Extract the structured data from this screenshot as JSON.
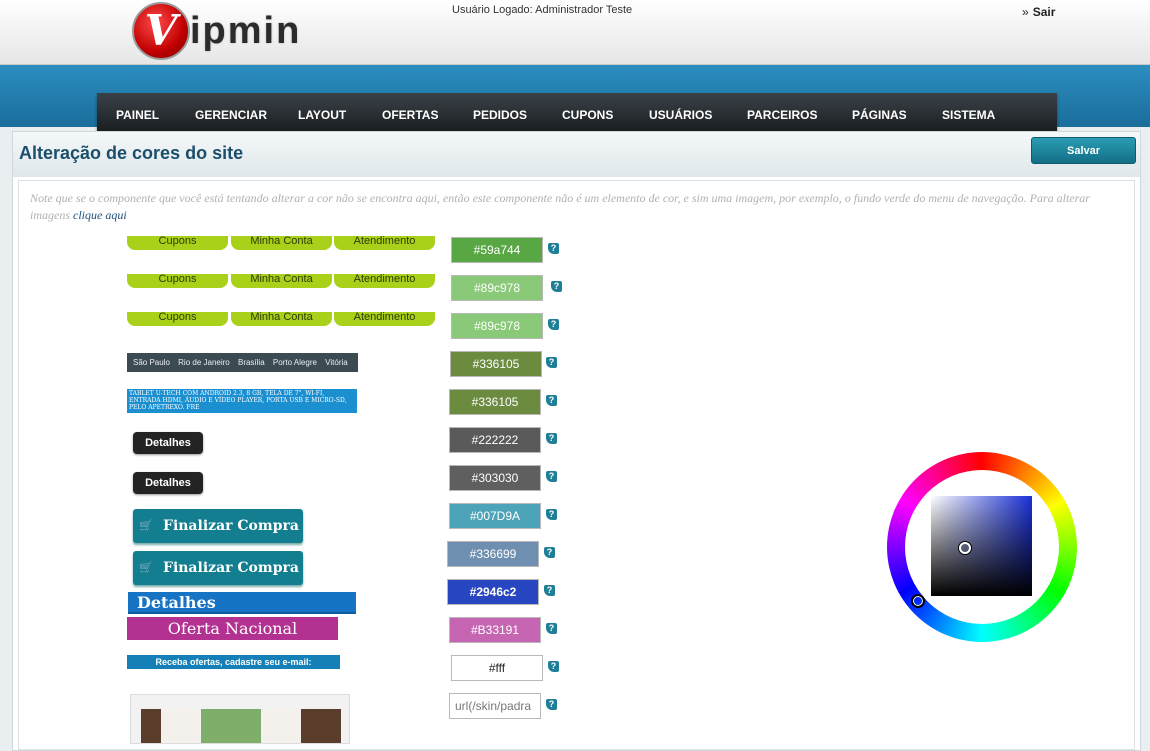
{
  "header": {
    "logo_v": "V",
    "logo_rest": "ipmin",
    "user_info": "Usuário Logado: Administrador Teste",
    "logout_arrow": "»",
    "logout": "Sair"
  },
  "nav": [
    "PAINEL",
    "GERENCIAR",
    "LAYOUT",
    "OFERTAS",
    "PEDIDOS",
    "CUPONS",
    "USUÁRIOS",
    "PARCEIROS",
    "PÁGINAS",
    "SISTEMA"
  ],
  "page": {
    "title": "Alteração de cores do site",
    "save_label": "Salvar",
    "note": "Note que se o componente que você está tentando alterar a cor não se encontra aqui, então este componente não é um elemento de cor, e sim uma imagem, por exemplo, o fundo verde do menu de navegação. Para alterar imagens ",
    "note_link": "clique aqui"
  },
  "previews": {
    "menu_tabs": [
      "Cupons",
      "Minha Conta",
      "Atendimento"
    ],
    "cities": [
      "São Paulo",
      "Rio de Janeiro",
      "Brasília",
      "Porto Alegre",
      "Vitória"
    ],
    "tablet_text": "TABLET U-TECH COM ANDROID 2.3, 8 GB, TELA DE 7\", WI-FI, ENTRADA HDMI, ÁUDIO E VÍDEO PLAYER, PORTA USB E MICRO-SD, PELO APETREXO. FRE",
    "detalhes": "Detalhes",
    "cart_icon": "🛒",
    "finalizar": "Finalizar Compra",
    "detalhes_blue": "Detalhes",
    "oferta": "Oferta Nacional",
    "receba": "Receba ofertas, cadastre seu e-mail:"
  },
  "colors": [
    {
      "value": "#59a744",
      "bg": "#59a744",
      "fg": "#ffffff"
    },
    {
      "value": "#89c978",
      "bg": "#89c978",
      "fg": "#ffffff"
    },
    {
      "value": "#89c978",
      "bg": "#89c978",
      "fg": "#ffffff"
    },
    {
      "value": "#336105",
      "bg": "#6b8b3f",
      "fg": "#ffffff"
    },
    {
      "value": "#336105",
      "bg": "#6b8b3f",
      "fg": "#ffffff"
    },
    {
      "value": "#222222",
      "bg": "#5a5a5a",
      "fg": "#ffffff"
    },
    {
      "value": "#303030",
      "bg": "#5f5f5f",
      "fg": "#ffffff"
    },
    {
      "value": "#007D9A",
      "bg": "#4da4b8",
      "fg": "#ffffff"
    },
    {
      "value": "#336699",
      "bg": "#6f8fb0",
      "fg": "#ffffff"
    },
    {
      "value": "#2946c2",
      "bg": "#2946c2",
      "fg": "#ffffff"
    },
    {
      "value": "#B33191",
      "bg": "#c666b3",
      "fg": "#ffffff"
    },
    {
      "value": "#fff",
      "bg": "#ffffff",
      "fg": "#222222"
    },
    {
      "value": "url(/skin/padra",
      "bg": "#ffffff",
      "fg": "#777777"
    }
  ],
  "help_glyph": "?",
  "picker": {
    "hue_color": "#1a30d6"
  }
}
